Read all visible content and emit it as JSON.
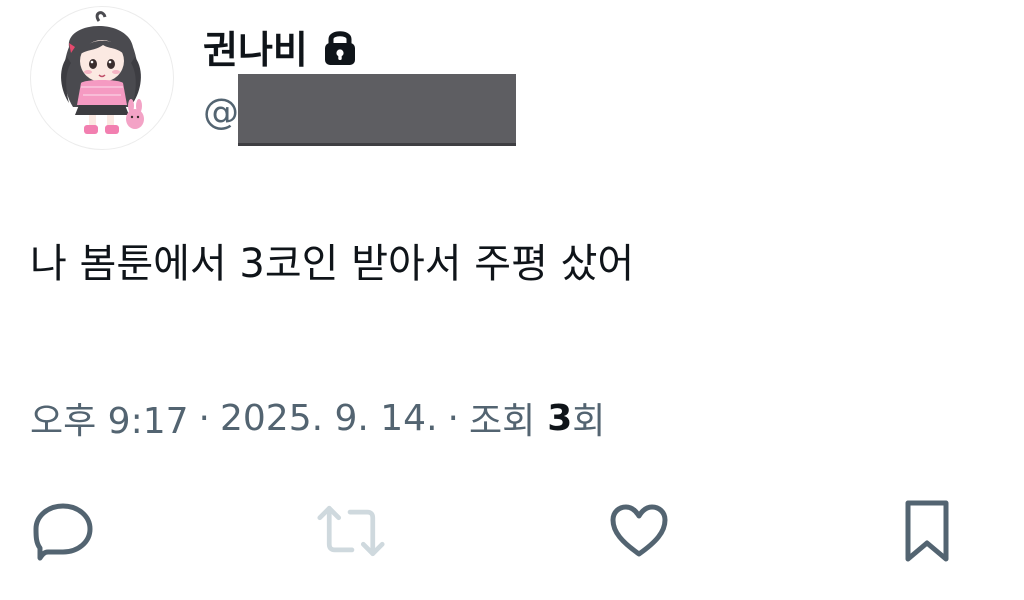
{
  "profile": {
    "display_name": "권나비",
    "handle_prefix": "@",
    "avatar_icon": "avatar-illustration",
    "protected_icon": "lock-icon"
  },
  "tweet": {
    "text": "나 봄툰에서 3코인 받아서 주평 샀어"
  },
  "meta": {
    "time": "오후 9:17",
    "separator": "·",
    "date": "2025. 9. 14.",
    "views_label": "조회",
    "views_count": "3",
    "views_suffix": "회"
  },
  "actions": [
    {
      "name": "reply",
      "icon": "reply-icon"
    },
    {
      "name": "retweet",
      "icon": "retweet-icon",
      "state": "disabled"
    },
    {
      "name": "like",
      "icon": "heart-icon"
    },
    {
      "name": "bookmark",
      "icon": "bookmark-icon"
    }
  ],
  "colors": {
    "text": "#0f1419",
    "secondary": "#536471",
    "retweet_disabled": "#cfd9de",
    "redaction": "#5e5e62"
  }
}
